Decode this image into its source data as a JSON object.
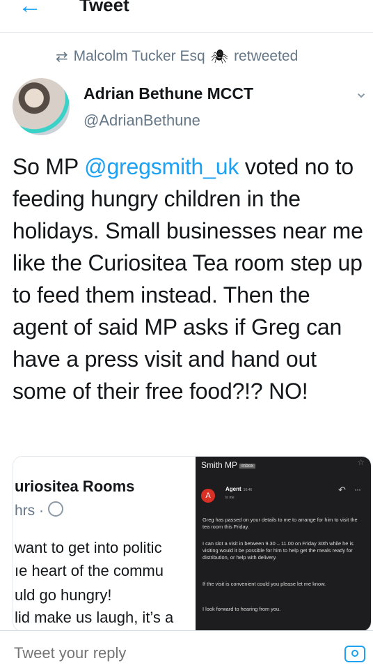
{
  "header": {
    "title": "Tweet",
    "back_icon": "arrow-left-icon"
  },
  "retweet": {
    "icon": "retweet-icon",
    "user": "Malcolm Tucker Esq",
    "emoji": "🕷",
    "label": "retweeted"
  },
  "author": {
    "name": "Adrian Bethune MCCT",
    "handle": "@AdrianBethune"
  },
  "tweet": {
    "before_mention": "So MP ",
    "mention": "@gregsmith_uk",
    "after_mention": " voted no to feeding hungry children in the holidays. Small businesses near me like the Curiositea Tea room step up to feed them instead. Then the agent of said MP asks if Greg can have a press visit and hand out some of their free food?!? NO!"
  },
  "media": {
    "left": {
      "name": "uriositea Rooms",
      "meta": "hrs ·",
      "lines": [
        "want to get into politic",
        "ıe heart of the commu",
        "uld go hungry!",
        "lid make us laugh, it’s a"
      ]
    },
    "email": {
      "subject": "Smith MP",
      "tag": "Inbox",
      "avatar_letter": "A",
      "sender": "Agent",
      "time": "10:46",
      "to": "to me",
      "paragraphs": [
        "Greg has passed on your details to me to arrange for him to visit the tea room this Friday.",
        "I can slot a visit in between 9.30 – 11.00 on Friday 30th while he is visiting would it be possible for him to help get the meals ready for distribution, or help with delivery.",
        "If the visit is convenient could you please let me know.",
        "I look forward to hearing from you."
      ]
    }
  },
  "reply": {
    "placeholder": "Tweet your reply",
    "camera_icon": "camera-icon"
  },
  "colors": {
    "accent": "#1da1f2",
    "text": "#14171a",
    "muted": "#657786",
    "email_bg": "#1d1d1f"
  }
}
